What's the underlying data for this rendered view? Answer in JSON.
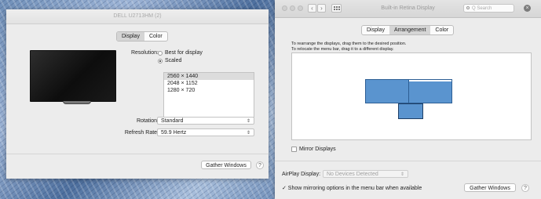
{
  "left_window": {
    "title": "DELL U2713HM (2)",
    "tabs": [
      "Display",
      "Color"
    ],
    "resolution_label": "Resolution:",
    "options": [
      "Best for display",
      "Scaled"
    ],
    "resolutions": [
      "2560 × 1440",
      "2048 × 1152",
      "1280 × 720"
    ],
    "rotation_label": "Rotation:",
    "rotation_value": "Standard",
    "refresh_label": "Refresh Rate:",
    "refresh_value": "59.9 Hertz",
    "gather_button": "Gather Windows",
    "help": "?"
  },
  "right_window": {
    "title": "Built-in Retina Display",
    "search_placeholder": "Q Search",
    "back_glyph": "‹",
    "forward_glyph": "›",
    "close_glyph": "×",
    "tabs": [
      "Display",
      "Arrangement",
      "Color"
    ],
    "instructions": [
      "To rearrange the displays, drag them to the desired position.",
      "To relocate the menu bar, drag it to a different display."
    ],
    "mirror_label": "Mirror Displays",
    "airplay_label": "AirPlay Display:",
    "airplay_value": "No Devices Detected",
    "show_mirroring_label": "✓ Show mirroring options in the menu bar when available",
    "gather_button": "Gather Windows",
    "help": "?"
  },
  "icons": {
    "radio": "radio-button",
    "dropdown": "up-down-chevron-icon",
    "grid": "show-all-grid-icon",
    "search": "search-icon",
    "close": "close-icon"
  },
  "colors": {
    "display_fill": "#5a94cf",
    "display_border": "#2d5e94",
    "window_bg": "#ececec"
  }
}
